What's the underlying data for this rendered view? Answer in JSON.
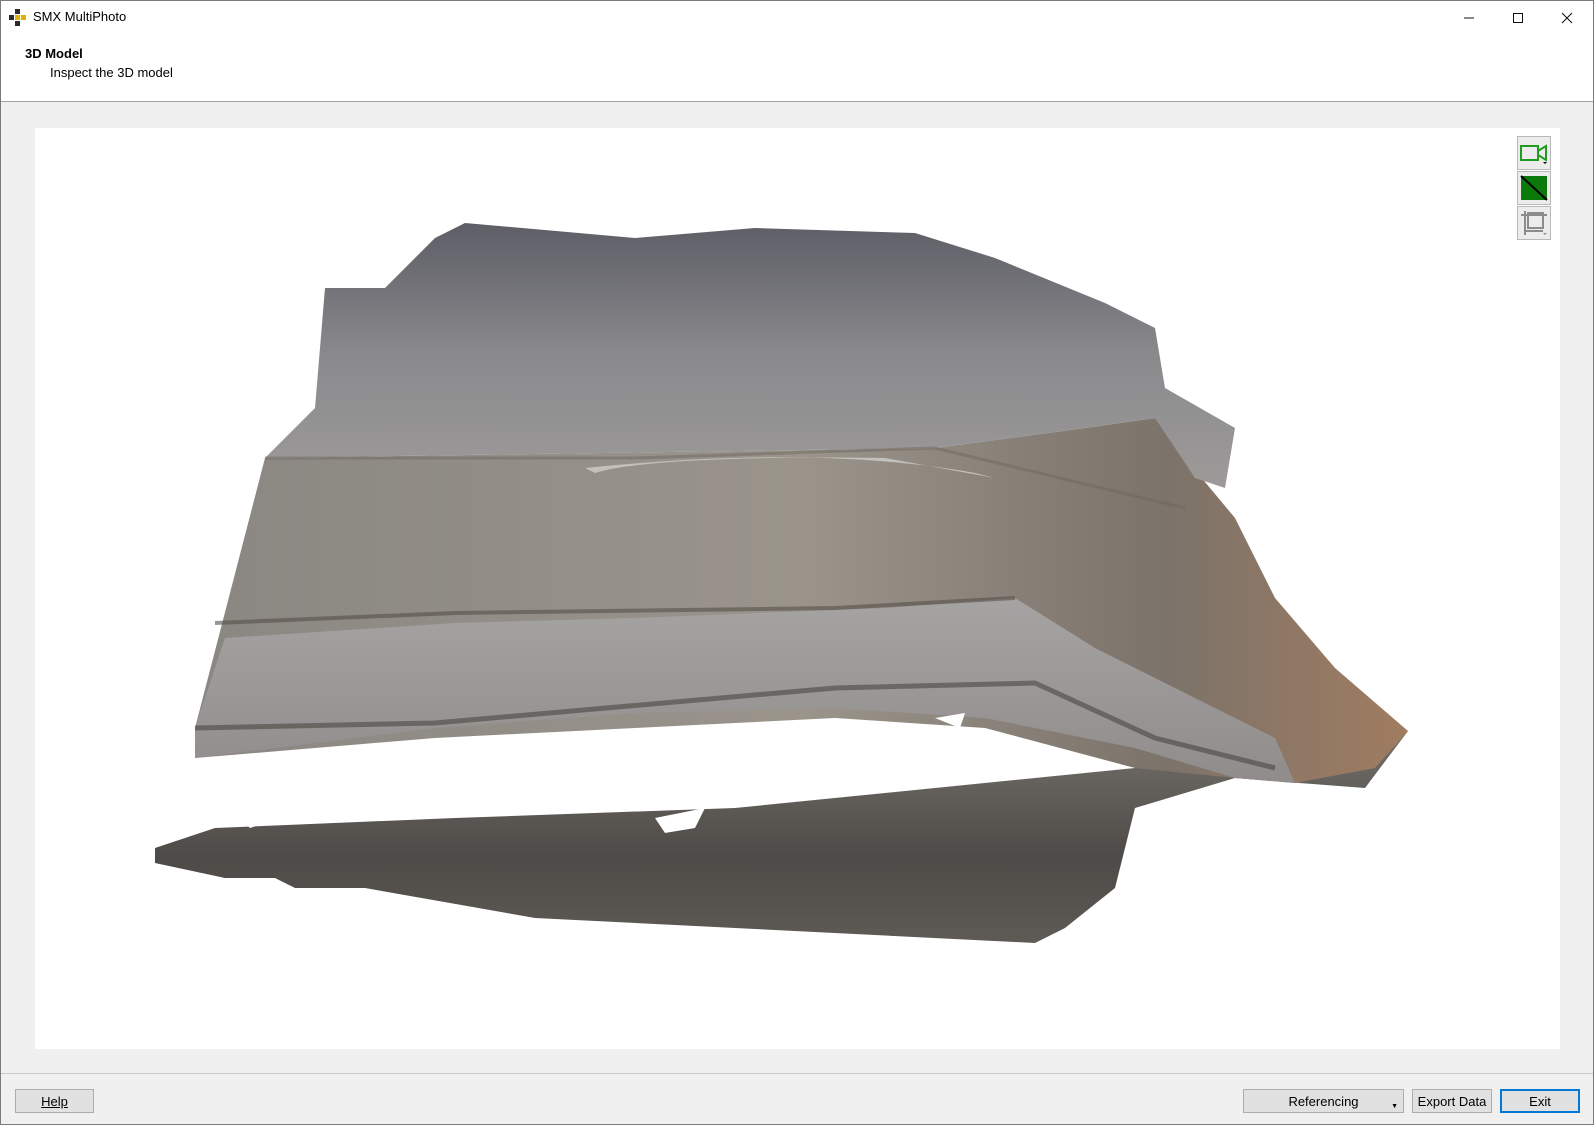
{
  "window": {
    "title": "SMX MultiPhoto",
    "controls": {
      "minimize": "—",
      "maximize": "☐",
      "close": "✕"
    },
    "icon": "smx-app-icon"
  },
  "header": {
    "title": "3D Model",
    "subtitle": "Inspect the 3D model"
  },
  "viewer": {
    "content": "textured 3D mesh of an open-pit quarry",
    "tools": [
      {
        "name": "camera-icon",
        "color": "#1f9b1f"
      },
      {
        "name": "shading-icon",
        "color": "#0b7a0b"
      },
      {
        "name": "bounding-box-icon",
        "color": "#8c8c8c"
      }
    ]
  },
  "footer": {
    "help_label": "Help",
    "referencing_label": "Referencing",
    "export_label": "Export Data",
    "exit_label": "Exit"
  },
  "colors": {
    "accent": "#0078d7",
    "window_bg": "#f0f0f0",
    "header_bg": "#ffffff",
    "button_bg": "#e1e1e1"
  }
}
